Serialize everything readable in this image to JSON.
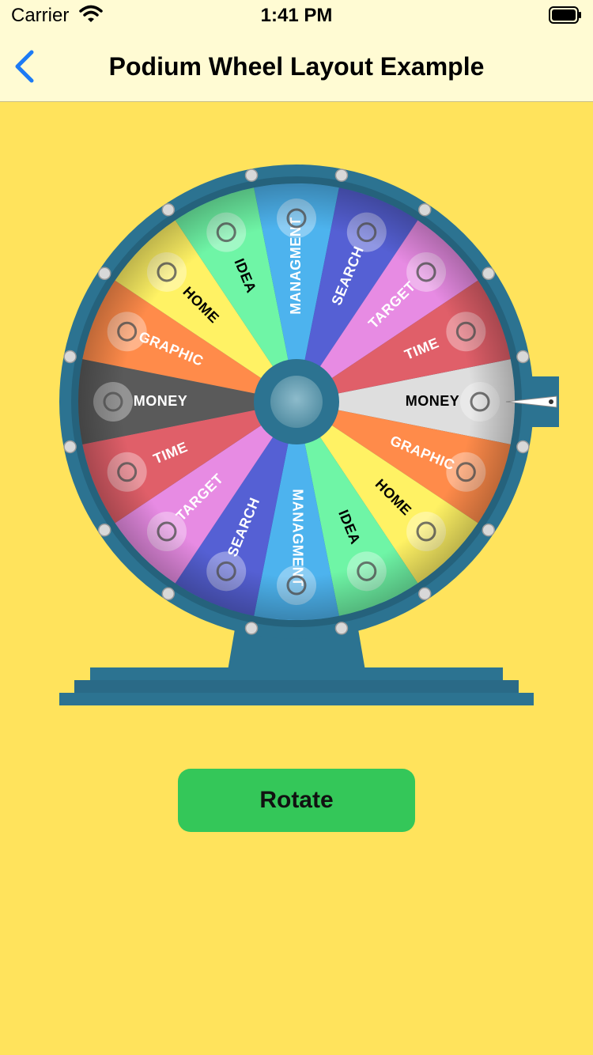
{
  "status": {
    "carrier": "Carrier",
    "time": "1:41 PM"
  },
  "nav": {
    "title": "Podium Wheel Layout Example",
    "back_icon": "chevron-left-icon",
    "accent": "#1D7BF5"
  },
  "wheel": {
    "segments": [
      {
        "label": "MONEY",
        "color": "#DEDEDE",
        "text_color": "#000000",
        "icon": "money-icon"
      },
      {
        "label": "GRAPHIC",
        "color": "#FF8B4A",
        "text_color": "#FFFFFF",
        "icon": "graphic-icon"
      },
      {
        "label": "HOME",
        "color": "#FFF264",
        "text_color": "#000000",
        "icon": "home-icon"
      },
      {
        "label": "IDEA",
        "color": "#6FF5A6",
        "text_color": "#000000",
        "icon": "idea-icon"
      },
      {
        "label": "MANAGMENT",
        "color": "#4DB3EE",
        "text_color": "#FFFFFF",
        "icon": "management-icon"
      },
      {
        "label": "SEARCH",
        "color": "#5560D4",
        "text_color": "#FFFFFF",
        "icon": "search-icon"
      },
      {
        "label": "TARGET",
        "color": "#E78BE3",
        "text_color": "#FFFFFF",
        "icon": "target-icon"
      },
      {
        "label": "TIME",
        "color": "#E05F69",
        "text_color": "#FFFFFF",
        "icon": "time-icon"
      },
      {
        "label": "MONEY",
        "color": "#5A5A5A",
        "text_color": "#FFFFFF",
        "icon": "money-icon"
      },
      {
        "label": "GRAPHIC",
        "color": "#FF8B4A",
        "text_color": "#FFFFFF",
        "icon": "graphic-icon"
      },
      {
        "label": "HOME",
        "color": "#FFF264",
        "text_color": "#000000",
        "icon": "home-icon"
      },
      {
        "label": "IDEA",
        "color": "#6FF5A6",
        "text_color": "#000000",
        "icon": "idea-icon"
      },
      {
        "label": "MANAGMENT",
        "color": "#4DB3EE",
        "text_color": "#FFFFFF",
        "icon": "management-icon"
      },
      {
        "label": "SEARCH",
        "color": "#5560D4",
        "text_color": "#FFFFFF",
        "icon": "search-icon"
      },
      {
        "label": "TARGET",
        "color": "#E78BE3",
        "text_color": "#FFFFFF",
        "icon": "target-icon"
      },
      {
        "label": "TIME",
        "color": "#E05F69",
        "text_color": "#FFFFFF",
        "icon": "time-icon"
      }
    ],
    "rim_color": "#2C7391",
    "hub_color": "#6FA3B5",
    "stand_color": "#2C7391"
  },
  "actions": {
    "rotate_label": "Rotate",
    "rotate_color": "#34C759"
  }
}
